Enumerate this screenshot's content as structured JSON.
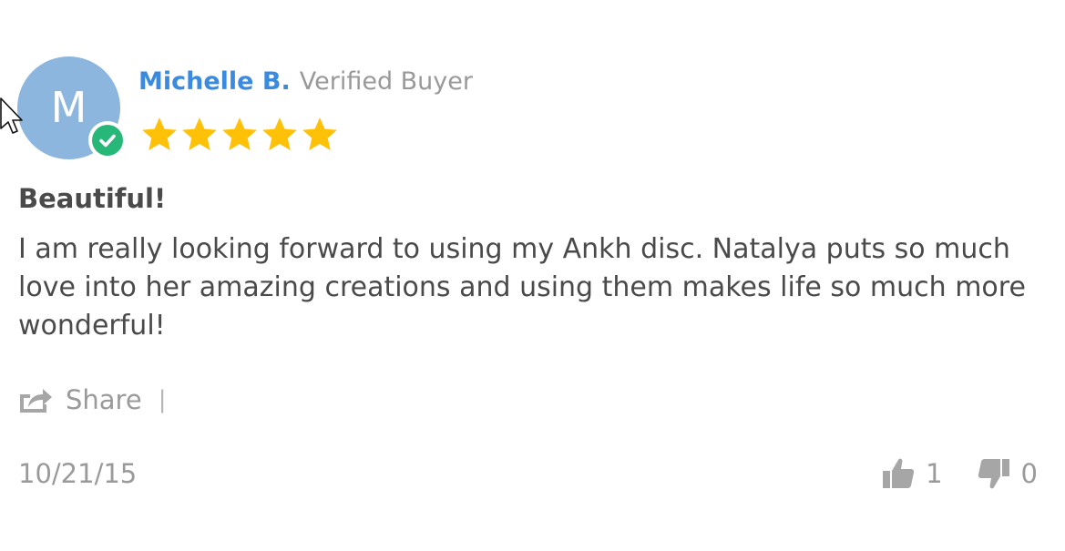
{
  "reviewer": {
    "initial": "M",
    "name": "Michelle B.",
    "badge": "Verified Buyer",
    "avatar_color": "#8db6df",
    "verified_color": "#27b879"
  },
  "rating": {
    "value": 5,
    "max": 5,
    "star_color": "#ffc107"
  },
  "review": {
    "title": "Beautiful!",
    "body": "I am really looking forward to using my Ankh disc. Natalya puts so much love into her amazing creations and using them makes life so much more wonderful!",
    "date": "10/21/15"
  },
  "actions": {
    "share_label": "Share",
    "divider": "|",
    "share_icon": "share-icon"
  },
  "votes": {
    "up_count": "1",
    "down_count": "0",
    "up_icon": "thumbs-up-icon",
    "down_icon": "thumbs-down-icon"
  }
}
